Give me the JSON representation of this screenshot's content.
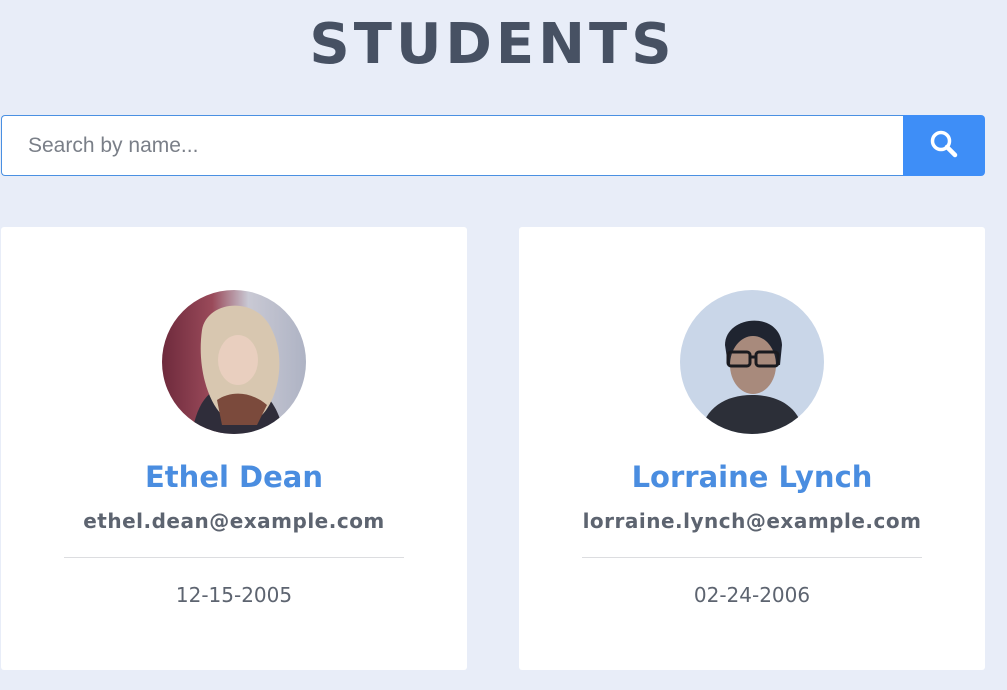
{
  "page": {
    "title": "STUDENTS"
  },
  "search": {
    "placeholder": "Search by name...",
    "value": "",
    "button_icon": "search-icon"
  },
  "students": [
    {
      "name": "Ethel Dean",
      "email": "ethel.dean@example.com",
      "dob": "12-15-2005",
      "avatar": "profile-photo"
    },
    {
      "name": "Lorraine Lynch",
      "email": "lorraine.lynch@example.com",
      "dob": "02-24-2006",
      "avatar": "profile-photo"
    }
  ],
  "colors": {
    "background": "#e8edf8",
    "title": "#475163",
    "accent": "#3e8ef7",
    "name": "#4a8de0",
    "text": "#5d6470"
  }
}
